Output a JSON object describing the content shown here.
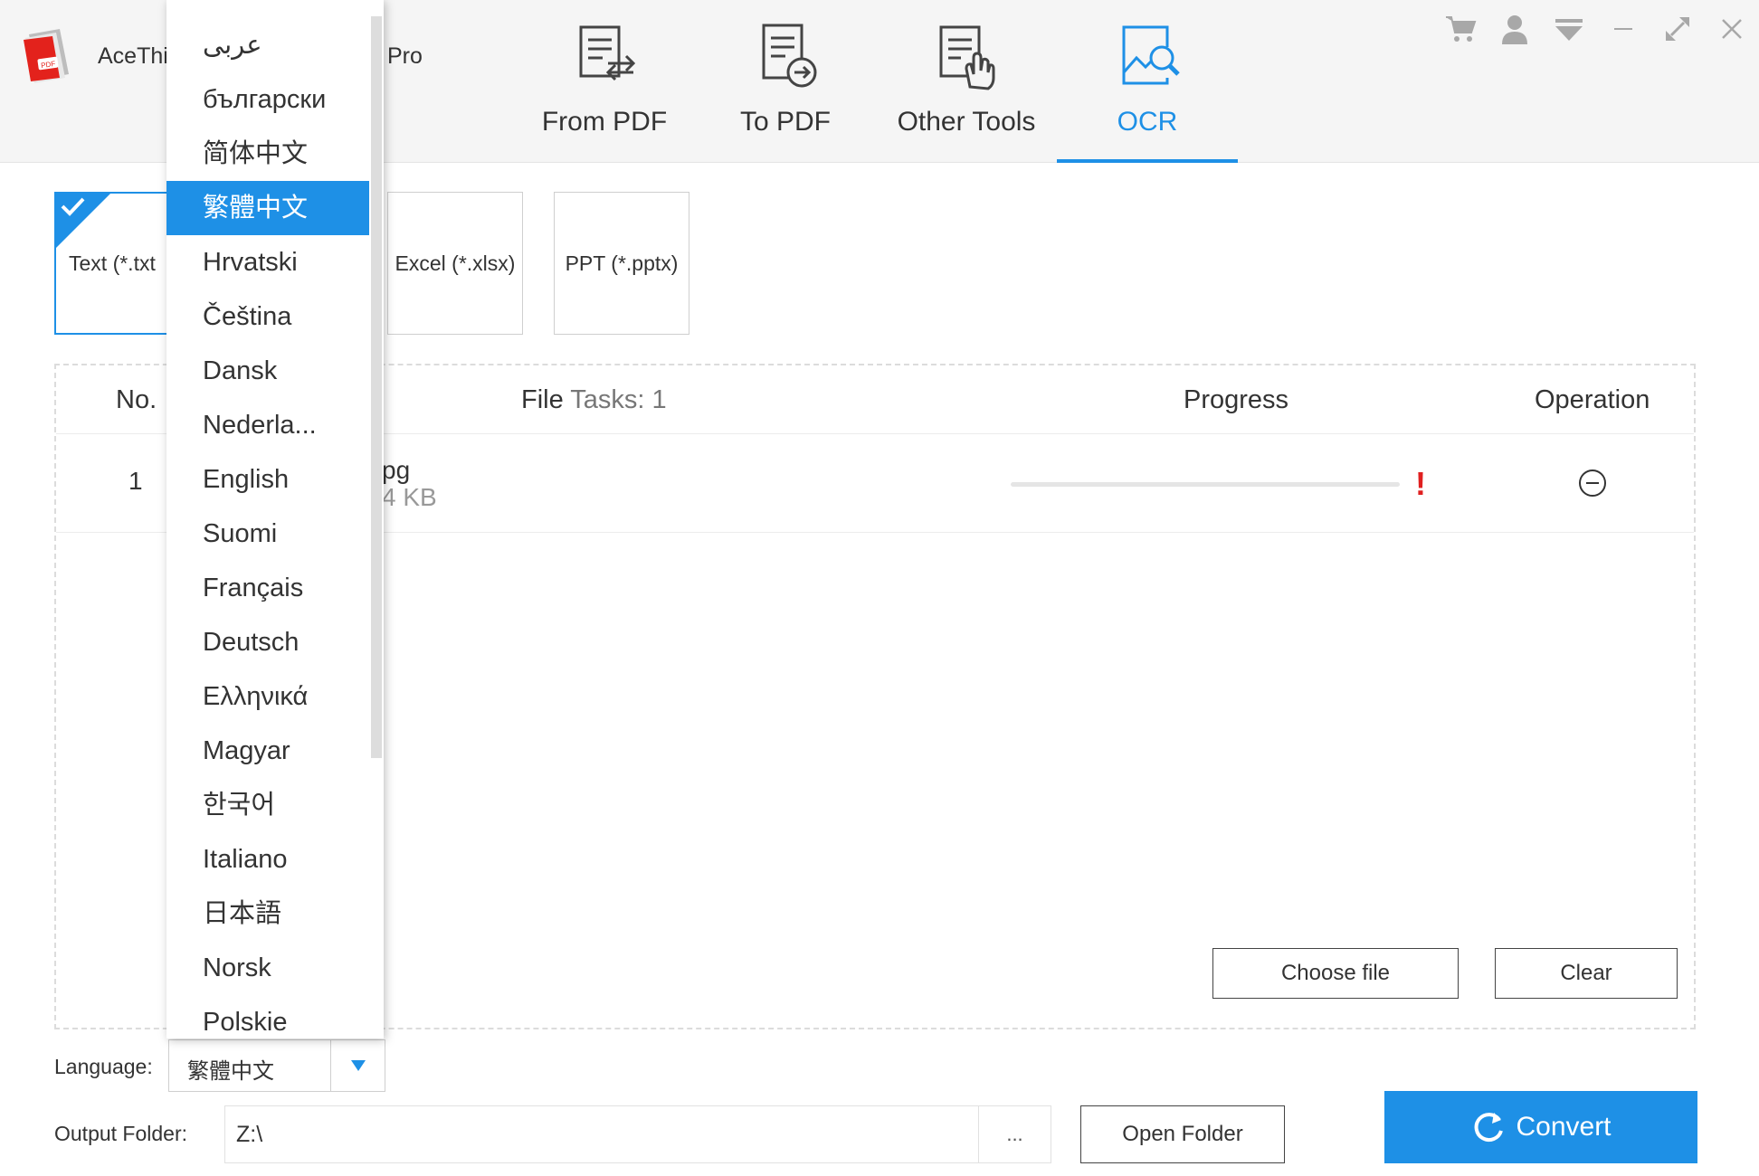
{
  "app": {
    "title": "AceThi",
    "title_suffix": "Pro"
  },
  "nav": {
    "tabs": [
      {
        "label": "From PDF",
        "icon": "from-pdf-icon",
        "active": false
      },
      {
        "label": "To PDF",
        "icon": "to-pdf-icon",
        "active": false
      },
      {
        "label": "Other Tools",
        "icon": "other-tools-icon",
        "active": false
      },
      {
        "label": "OCR",
        "icon": "ocr-icon",
        "active": true
      }
    ]
  },
  "window_controls": [
    "cart-icon",
    "user-icon",
    "menu-icon",
    "minimize-icon",
    "maximize-icon",
    "close-icon"
  ],
  "formats": [
    {
      "label": "Text (*.txt",
      "selected": true
    },
    {
      "label": "Excel (*.xlsx)",
      "selected": false
    },
    {
      "label": "PPT (*.pptx)",
      "selected": false
    }
  ],
  "table": {
    "col_no": "No.",
    "col_file": "File",
    "col_tasks": "Tasks: 1",
    "col_progress": "Progress",
    "col_operation": "Operation",
    "rows": [
      {
        "no": "1",
        "name": "pg",
        "size": "4 KB",
        "progress": 0,
        "status": "!"
      }
    ]
  },
  "buttons": {
    "choose_file": "Choose file",
    "clear": "Clear",
    "browse": "...",
    "open_folder": "Open Folder",
    "convert": "Convert"
  },
  "language": {
    "label": "Language:",
    "selected": "繁體中文",
    "options": [
      "عربى",
      "български",
      "简体中文",
      "繁體中文",
      "Hrvatski",
      "Čeština",
      "Dansk",
      "Nederla...",
      "English",
      "Suomi",
      "Français",
      "Deutsch",
      "Ελληνικά",
      "Magyar",
      "한국어",
      "Italiano",
      "日本語",
      "Norsk",
      "Polskie"
    ],
    "selected_index": 3
  },
  "output": {
    "label": "Output Folder:",
    "value": "Z:\\"
  },
  "colors": {
    "accent": "#1e90e6",
    "error": "#e02020"
  }
}
